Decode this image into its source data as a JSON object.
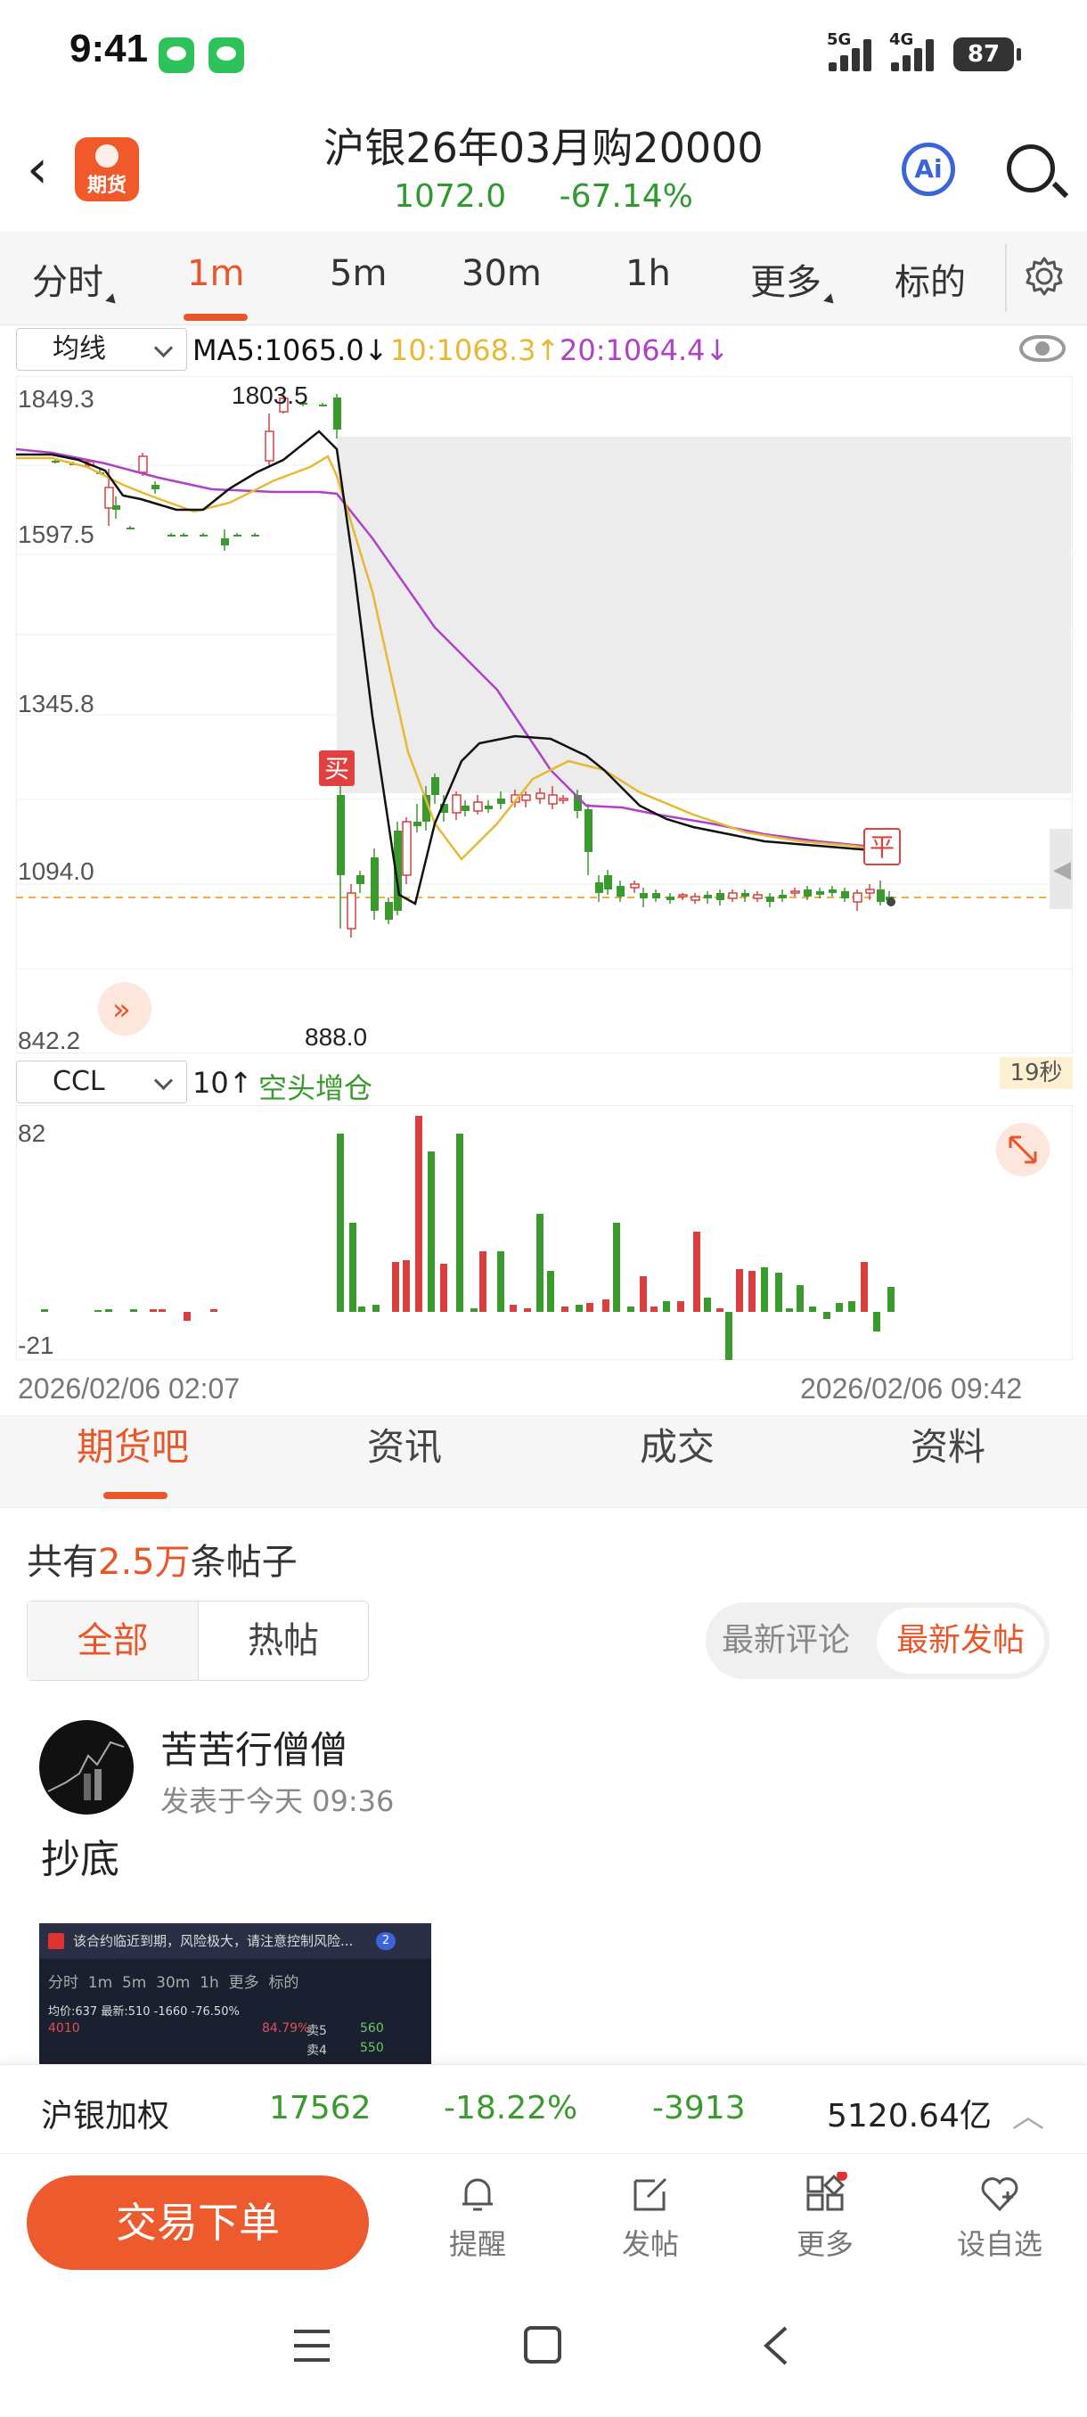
{
  "status": {
    "time": "9:41",
    "net1": "5G",
    "net2": "4G",
    "battery": "87"
  },
  "header": {
    "back": "‹",
    "logo_text": "期货",
    "title": "沪银26年03月购20000",
    "price": "1072.0",
    "change": "-67.14%",
    "ai": "Ai"
  },
  "tabs": [
    "分时",
    "1m",
    "5m",
    "30m",
    "1h",
    "更多",
    "标的"
  ],
  "indicator": {
    "select": "均线",
    "ma5": "MA5:1065.0↓",
    "ma10": "10:1068.3↑",
    "ma20": "20:1064.4↓"
  },
  "chart_data": {
    "type": "candlestick",
    "y_labels": [
      "1849.3",
      "1597.5",
      "1345.8",
      "1094.0",
      "842.2"
    ],
    "ylim": [
      842.2,
      1849.3
    ],
    "high_label": "1803.5",
    "low_label": "888.0",
    "buy_marker": "买",
    "close_marker": "平",
    "timer": "19秒",
    "colors": {
      "up": "#d84040",
      "down": "#3a9a2e",
      "ma5": "#111111",
      "ma10": "#e8b830",
      "ma20": "#b040c8"
    }
  },
  "sub": {
    "select": "CCL",
    "value": "10↑",
    "status": "空头增仓",
    "top": "82",
    "bottom": "-21",
    "time_start": "2026/02/06 02:07",
    "time_end": "2026/02/06 09:42"
  },
  "lower_tabs": [
    "期货吧",
    "资讯",
    "成交",
    "资料"
  ],
  "posts": {
    "prefix": "共有",
    "count": "2.5万",
    "suffix": "条帖子",
    "filter_all": "全部",
    "filter_hot": "热帖",
    "sort_comment": "最新评论",
    "sort_post": "最新发帖"
  },
  "post": {
    "user": "苦苦行僧僧",
    "time": "发表于今天 09:36",
    "content": "抄底",
    "thumb_warn": "该合约临近到期，风险极大，请注意控制风险...",
    "thumb_tabs": "分时  1m  5m  30m  1h  更多  标的",
    "thumb_line": "均价:637 最新:510 -1660 -76.50%",
    "thumb_v1": "4010",
    "thumb_v2": "84.79%",
    "thumb_s5": "卖5",
    "thumb_s4": "卖4",
    "thumb_p5": "560",
    "thumb_p4": "550",
    "thumb_badge": "2"
  },
  "ticker": {
    "name": "沪银加权",
    "price": "17562",
    "pct": "-18.22%",
    "chg": "-3913",
    "amount": "5120.64亿"
  },
  "bottom": {
    "trade": "交易下单",
    "alert": "提醒",
    "post": "发帖",
    "more": "更多",
    "watch": "设自选"
  }
}
